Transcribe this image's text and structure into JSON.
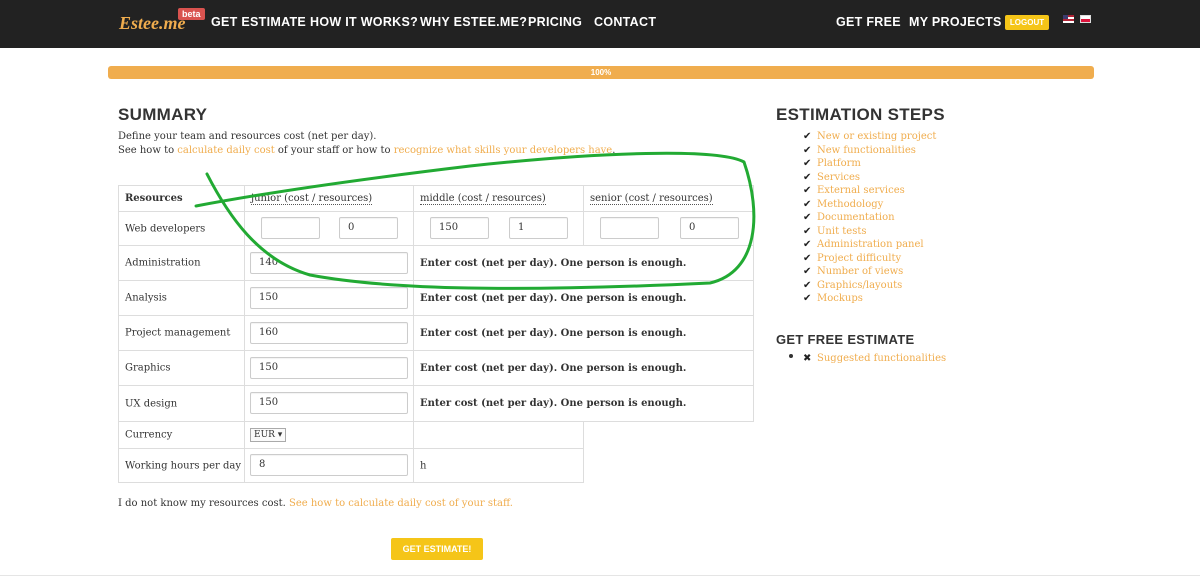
{
  "nav": {
    "logo": "Estee.me",
    "beta": "beta",
    "left_links": [
      "GET ESTIMATE",
      "HOW IT WORKS?",
      "WHY ESTEE.ME?",
      "PRICING",
      "CONTACT"
    ],
    "right_links": [
      "GET FREE",
      "MY PROJECTS"
    ],
    "logout": "LOGOUT"
  },
  "progress": {
    "value": 1.0,
    "label": "100%"
  },
  "summary": {
    "title": "SUMMARY",
    "desc1": "Define your team and resources cost (net per day).",
    "desc2_pre": "See how to ",
    "desc2_link1": "calculate daily cost",
    "desc2_mid": " of your staff or how to ",
    "desc2_link2": "recognize what skills your developers have",
    "desc2_post": "."
  },
  "table": {
    "headers": {
      "resources": "Resources",
      "junior": "junior (cost / resources)",
      "middle": "middle (cost / resources)",
      "senior": "senior (cost / resources)"
    },
    "web": {
      "label": "Web developers",
      "junior_cost": "",
      "junior_res": "0",
      "middle_cost": "150",
      "middle_res": "1",
      "senior_cost": "",
      "senior_res": "0"
    },
    "rows": [
      {
        "label": "Administration",
        "value": "140",
        "help": "Enter cost (net per day). One person is enough."
      },
      {
        "label": "Analysis",
        "value": "150",
        "help": "Enter cost (net per day). One person is enough."
      },
      {
        "label": "Project management",
        "value": "160",
        "help": "Enter cost (net per day). One person is enough."
      },
      {
        "label": "Graphics",
        "value": "150",
        "help": "Enter cost (net per day). One person is enough."
      },
      {
        "label": "UX design",
        "value": "150",
        "help": "Enter cost (net per day). One person is enough."
      }
    ],
    "currency": {
      "label": "Currency",
      "value": "EUR ▾"
    },
    "hours": {
      "label": "Working hours per day",
      "value": "8",
      "unit": "h"
    }
  },
  "bottom": {
    "note": "I do not know my resources cost. ",
    "note_link": "See how to calculate daily cost of your staff.",
    "button": "GET ESTIMATE!"
  },
  "steps": {
    "title": "ESTIMATION STEPS",
    "items": [
      "New or existing project",
      "New functionalities",
      "Platform",
      "Services",
      "External services",
      "Methodology",
      "Documentation",
      "Unit tests",
      "Administration panel",
      "Project difficulty",
      "Number of views",
      "Graphics/layouts",
      "Mockups"
    ]
  },
  "free": {
    "title": "GET FREE ESTIMATE",
    "items": [
      "Suggested functionalities"
    ]
  },
  "colors": {
    "accent": "#f0ad4e",
    "nav_bg": "#222222",
    "button": "#f5c518",
    "annotation": "#22aa33"
  },
  "icons": {
    "check": "check-icon",
    "cross": "cross-icon"
  }
}
